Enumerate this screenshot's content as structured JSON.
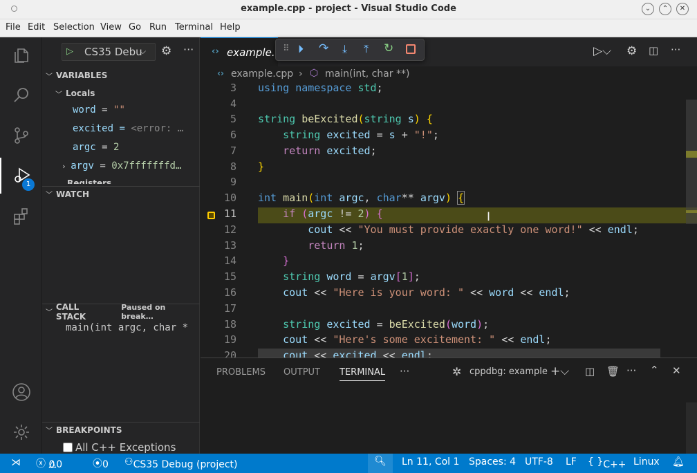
{
  "window": {
    "title": "example.cpp - project - Visual Studio Code"
  },
  "menu": [
    "File",
    "Edit",
    "Selection",
    "View",
    "Go",
    "Run",
    "Terminal",
    "Help"
  ],
  "activity": {
    "debug_badge": "1"
  },
  "sidebar": {
    "run_config": "CS35 Debu",
    "variables_header": "VARIABLES",
    "locals_header": "Locals",
    "variables": [
      {
        "name": "word",
        "value": "\"\""
      },
      {
        "name": "excited",
        "value": "<error: …"
      },
      {
        "name": "argc",
        "value": "2"
      },
      {
        "name": "argv",
        "value": "0x7fffffffd…"
      }
    ],
    "registers_label": "Registers",
    "watch_header": "WATCH",
    "callstack_header": "CALL STACK",
    "callstack_status": "Paused on break…",
    "callstack_frames": [
      "main(int argc, char *"
    ],
    "breakpoints_header": "BREAKPOINTS",
    "breakpoint_items": [
      "All C++ Exceptions"
    ]
  },
  "editor": {
    "tab_label": "example.c",
    "breadcrumb": {
      "file": "example.cpp",
      "symbol": "main(int, char **)"
    },
    "line_numbers": [
      "3",
      "4",
      "5",
      "6",
      "7",
      "8",
      "9",
      "10",
      "11",
      "12",
      "13",
      "14",
      "15",
      "16",
      "17",
      "18",
      "19",
      "20"
    ],
    "current_line": "11"
  },
  "panel": {
    "tabs": [
      "PROBLEMS",
      "OUTPUT",
      "TERMINAL"
    ],
    "active_tab": "TERMINAL",
    "terminal_name": "cppdbg: example"
  },
  "status": {
    "errors": "0",
    "warnings": "0",
    "ports": "0",
    "debug_session": "CS35 Debug (project)",
    "position": "Ln 11, Col 1",
    "spaces": "Spaces: 4",
    "encoding": "UTF-8",
    "eol": "LF",
    "language": "C++",
    "os": "Linux"
  },
  "colors": {
    "accent": "#007acc",
    "current_line_bg": "#4b4b18",
    "debug_continue": "#75beff",
    "debug_restart": "#89d185",
    "debug_stop": "#f48771"
  }
}
